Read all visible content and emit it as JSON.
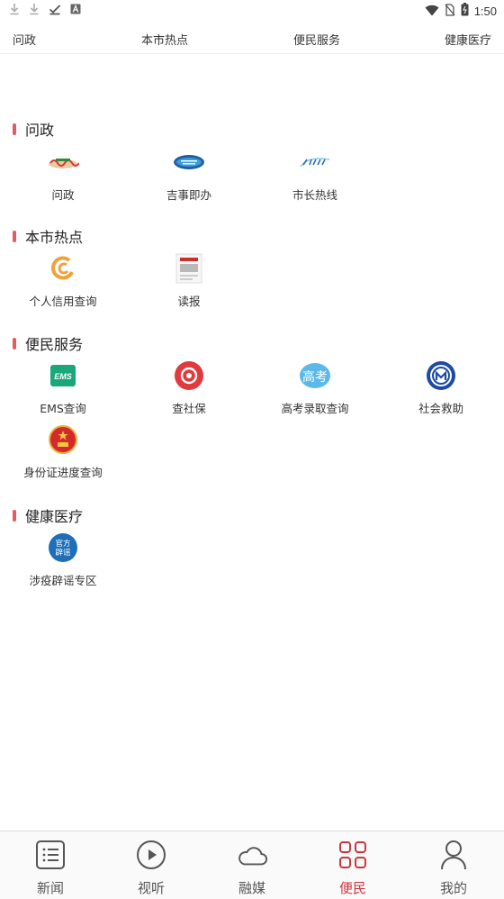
{
  "status_bar": {
    "time": "1:50"
  },
  "tabs": [
    "问政",
    "本市热点",
    "便民服务",
    "健康医疗"
  ],
  "sections": {
    "wenzheng": {
      "title": "问政",
      "items": [
        {
          "label": "问政",
          "icon": "wenzheng-logo-icon"
        },
        {
          "label": "吉事即办",
          "icon": "jishi-logo-icon"
        },
        {
          "label": "市长热线",
          "icon": "hotline-12345-icon"
        }
      ]
    },
    "hotspot": {
      "title": "本市热点",
      "items": [
        {
          "label": "个人信用查询",
          "icon": "credit-icon"
        },
        {
          "label": "读报",
          "icon": "newspaper-icon"
        }
      ]
    },
    "service": {
      "title": "便民服务",
      "items": [
        {
          "label": "EMS查询",
          "icon": "ems-icon",
          "text": "EMS"
        },
        {
          "label": "查社保",
          "icon": "social-security-icon"
        },
        {
          "label": "高考录取查询",
          "icon": "gaokao-icon",
          "text": "高考"
        },
        {
          "label": "社会救助",
          "icon": "social-aid-icon"
        },
        {
          "label": "身份证进度查询",
          "icon": "national-emblem-icon"
        }
      ]
    },
    "health": {
      "title": "健康医疗",
      "items": [
        {
          "label": "涉疫辟谣专区",
          "icon": "rumor-refute-icon",
          "text": "官方辟谣"
        }
      ]
    }
  },
  "bottom_nav": [
    {
      "label": "新闻",
      "icon": "news-list-icon"
    },
    {
      "label": "视听",
      "icon": "play-circle-icon"
    },
    {
      "label": "融媒",
      "icon": "cloud-icon"
    },
    {
      "label": "便民",
      "icon": "grid-icon",
      "active": true
    },
    {
      "label": "我的",
      "icon": "person-icon"
    }
  ],
  "colors": {
    "accent": "#c8383f",
    "section_bar": "#e35b5f"
  }
}
